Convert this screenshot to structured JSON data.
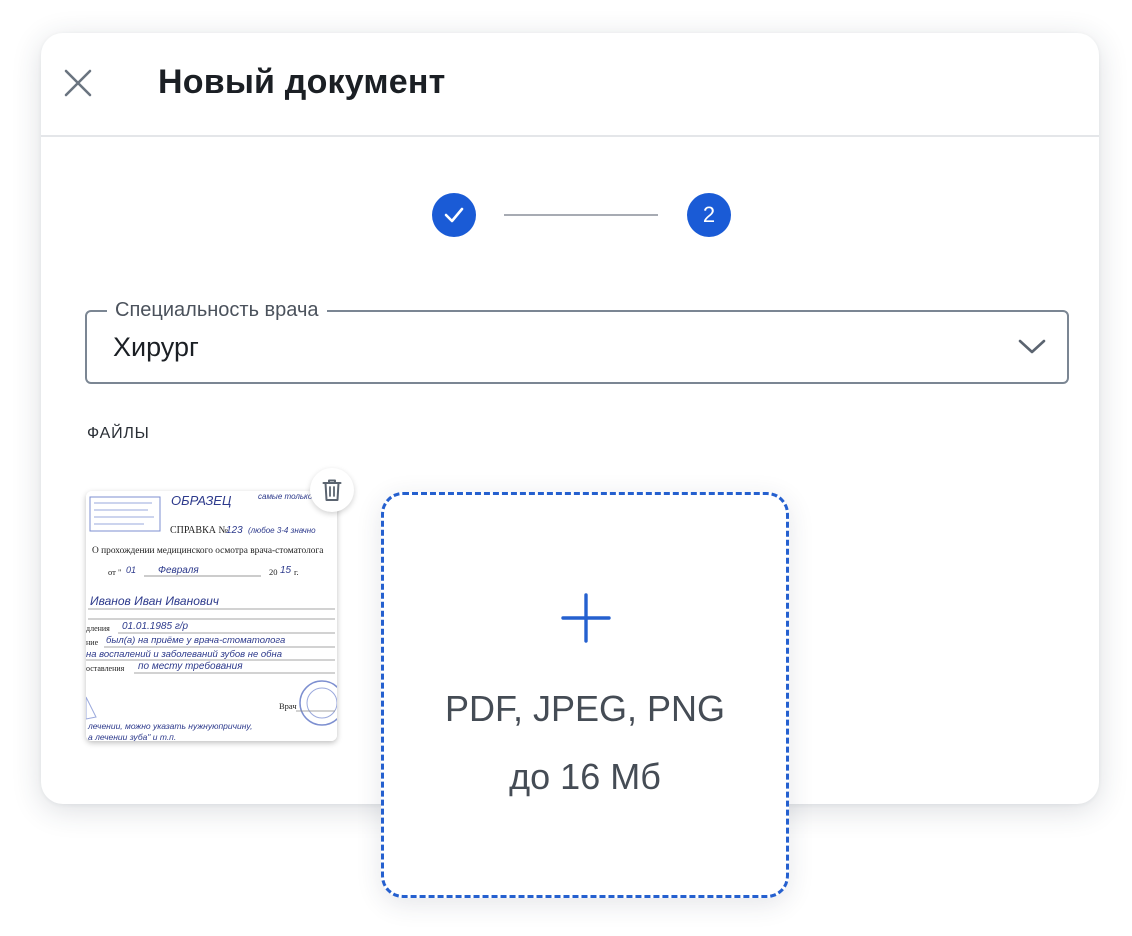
{
  "dialog": {
    "title": "Новый документ",
    "close_icon": "close-icon"
  },
  "stepper": {
    "steps": [
      {
        "label": "",
        "state": "completed",
        "icon": "check-icon"
      },
      {
        "label": "2",
        "state": "active"
      }
    ],
    "accent_color": "#1a5bd6"
  },
  "specialty_field": {
    "label": "Специальность врача",
    "value": "Хирург",
    "icon": "chevron-down-icon"
  },
  "files": {
    "section_label": "ФАЙЛЫ",
    "items": [
      {
        "type": "scanned-document-preview",
        "delete_icon": "trash-icon",
        "preview_text": {
          "stamp": "ОБРАЗЕЦ",
          "stamp_note": "самые только у",
          "certificate": "СПРАВКА №",
          "certificate_number": "123",
          "certificate_note": "(любое 3-4 значно",
          "subject": "О прохождении медицинского осмотра врача-стоматолога",
          "date_prefix": "от \"",
          "date_day": "01",
          "date_month": "Февраля",
          "date_year_prefix": "20",
          "date_year": "15",
          "date_suffix": "г.",
          "name": "Иванов Иван Иванович",
          "birth_label": "дления",
          "birth_value": "01.01.1985 г/р",
          "visit_label": "ние",
          "visit_value": "был(а) на приёме у врача-стоматолога",
          "visit_value_2": "на воспалений и заболеваний зубов не обна",
          "present_label": "оставления",
          "present_value": "по месту требования",
          "doctor_label": "Врач",
          "footnote_1": "лечении, можно указать нужнуюпричину,",
          "footnote_2": "а лечении зуба\" и т.п."
        }
      }
    ],
    "dropzone": {
      "icon": "plus-icon",
      "formats": "PDF, JPEG, PNG",
      "size_limit": "до 16 Мб",
      "border_color": "#2560cf"
    }
  }
}
